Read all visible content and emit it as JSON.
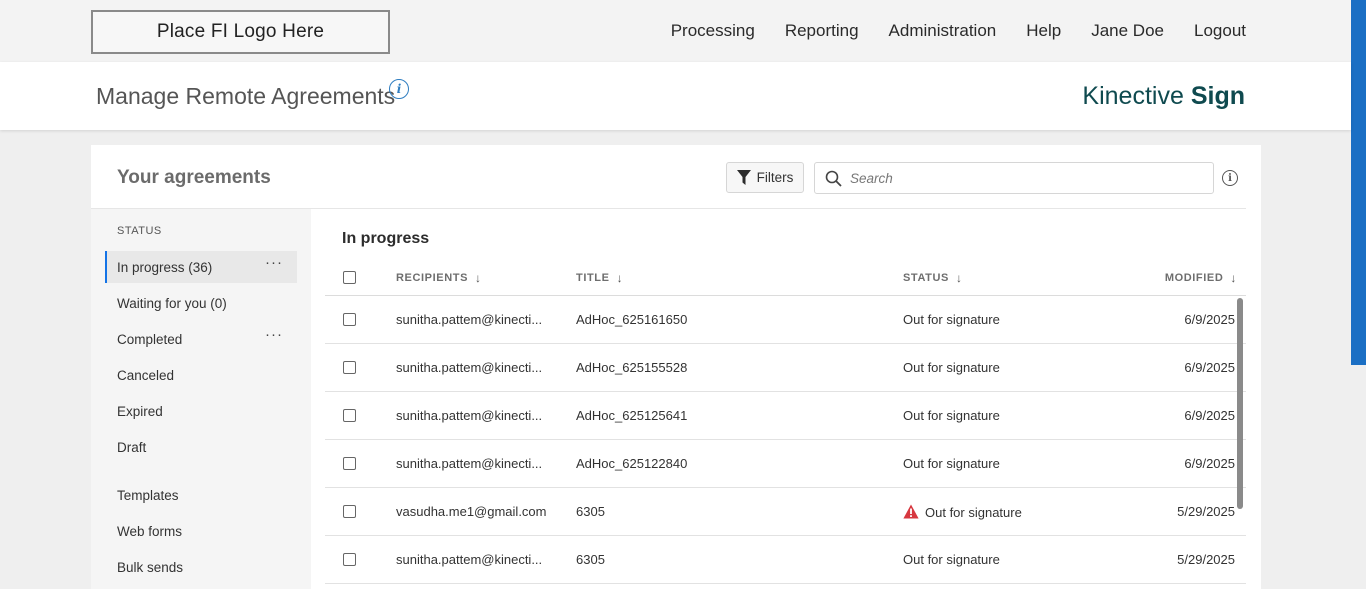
{
  "logo_placeholder": "Place FI Logo Here",
  "nav": [
    "Processing",
    "Reporting",
    "Administration",
    "Help",
    "Jane Doe",
    "Logout"
  ],
  "header": {
    "title": "Manage Remote Agreements",
    "info_glyph": "i",
    "brand_prefix": "Kinective",
    "brand_bold": "Sign"
  },
  "card": {
    "title": "Your agreements",
    "filters_label": "Filters",
    "search_placeholder": "Search",
    "info_glyph": "i"
  },
  "sidebar": {
    "status_label": "STATUS",
    "items": [
      {
        "label": "In progress (36)",
        "active": true,
        "more": "···"
      },
      {
        "label": "Waiting for you (0)"
      },
      {
        "label": "Completed",
        "more": "···"
      },
      {
        "label": "Canceled"
      },
      {
        "label": "Expired"
      },
      {
        "label": "Draft"
      },
      {
        "label": "Templates"
      },
      {
        "label": "Web forms"
      },
      {
        "label": "Bulk sends"
      }
    ]
  },
  "list": {
    "title": "In progress",
    "columns": {
      "recipients": "RECIPIENTS",
      "title": "TITLE",
      "status": "STATUS",
      "modified": "MODIFIED",
      "sort_arrow": "↓"
    },
    "rows": [
      {
        "recipient": "sunitha.pattem@kinecti...",
        "title": "AdHoc_625161650",
        "status": "Out for signature",
        "modified": "6/9/2025",
        "warning": false
      },
      {
        "recipient": "sunitha.pattem@kinecti...",
        "title": "AdHoc_625155528",
        "status": "Out for signature",
        "modified": "6/9/2025",
        "warning": false
      },
      {
        "recipient": "sunitha.pattem@kinecti...",
        "title": "AdHoc_625125641",
        "status": "Out for signature",
        "modified": "6/9/2025",
        "warning": false
      },
      {
        "recipient": "sunitha.pattem@kinecti...",
        "title": "AdHoc_625122840",
        "status": "Out for signature",
        "modified": "6/9/2025",
        "warning": false
      },
      {
        "recipient": "vasudha.me1@gmail.com",
        "title": "6305",
        "status": "Out for signature",
        "modified": "5/29/2025",
        "warning": true
      },
      {
        "recipient": "sunitha.pattem@kinecti...",
        "title": "6305",
        "status": "Out for signature",
        "modified": "5/29/2025",
        "warning": false
      }
    ]
  },
  "colors": {
    "accent": "#1473e6",
    "brand": "#0f4a4f",
    "warning": "#d7373f",
    "edge_stripe": "#1b6fc4"
  },
  "icons": {
    "filter": "filter-icon",
    "search": "search-icon",
    "info": "info-icon",
    "warning": "warning-icon"
  }
}
